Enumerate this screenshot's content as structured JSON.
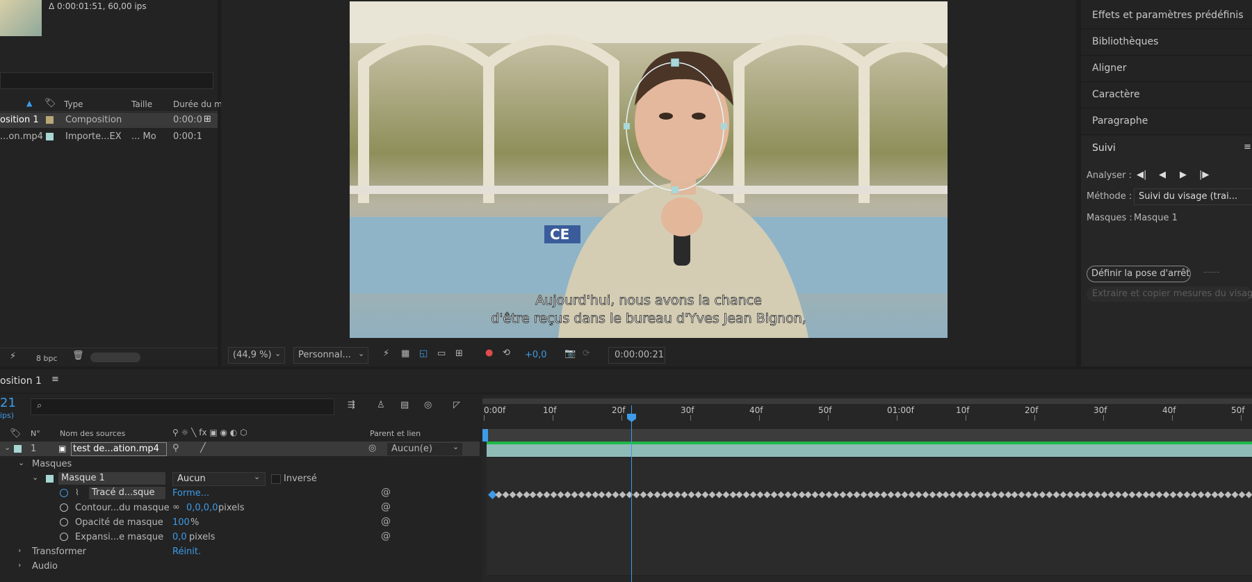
{
  "project": {
    "delta_info": "Δ 0:00:01:51, 60,00 ips",
    "columns": {
      "type": "Type",
      "size": "Taille",
      "duration": "Durée du mé"
    },
    "items": [
      {
        "name": "osition 1",
        "type": "Composition",
        "size": "",
        "duration": "0:00:0",
        "color": "#b9a77a"
      },
      {
        "name": "...on.mp4",
        "type": "Importe...EX",
        "size": "... Mo",
        "duration": "0:00:1",
        "color": "#a7d7d4"
      }
    ],
    "bpc": "8 bpc"
  },
  "viewer": {
    "subtitle_line1": "Aujourd'hui, nous avons la chance",
    "subtitle_line2": "d'être reçus dans le bureau d'Yves Jean Bignon,",
    "sign_text": "CE",
    "zoom": "(44,9 %)",
    "resolution": "Personnal...",
    "exposure": "+0,0",
    "timecode": "0:00:00:21"
  },
  "right_panel": {
    "items": [
      "Effets et paramètres prédéfinis",
      "Bibliothèques",
      "Aligner",
      "Caractère",
      "Paragraphe"
    ],
    "tracker": {
      "title": "Suivi",
      "analyze_label": "Analyser :",
      "method_label": "Méthode :",
      "method_value": "Suivi du visage (trai...",
      "masks_label": "Masques :",
      "masks_value": "Masque 1",
      "set_rest_pose": "Définir la pose d'arrêt",
      "extract_copy": "Extraire et copier mesures du visage"
    }
  },
  "timeline": {
    "comp_tab": "osition 1",
    "current_time": "21",
    "fps_hint": "ips)",
    "col_num": "N°",
    "col_source": "Nom des sources",
    "col_parent": "Parent et lien",
    "layer": {
      "num": "1",
      "name": "test de...ation.mp4",
      "parent": "Aucun(e)"
    },
    "masks_group": "Masques",
    "mask": {
      "name": "Masque 1",
      "mode": "Aucun",
      "inverted": "Inversé"
    },
    "props": [
      {
        "name": "Tracé d...sque",
        "value": "Forme...",
        "unit": ""
      },
      {
        "name": "Contour...du masque",
        "value": "0,0,0,0",
        "unit": "pixels"
      },
      {
        "name": "Opacité de masque",
        "value": "100",
        "unit": "%"
      },
      {
        "name": "Expansi...e masque",
        "value": "0,0",
        "unit": "pixels"
      }
    ],
    "transform": "Transformer",
    "transform_reset": "Réinit.",
    "audio": "Audio",
    "ruler": [
      "0:00f",
      "10f",
      "20f",
      "30f",
      "40f",
      "50f",
      "01:00f",
      "10f",
      "20f",
      "30f",
      "40f",
      "50f"
    ]
  }
}
